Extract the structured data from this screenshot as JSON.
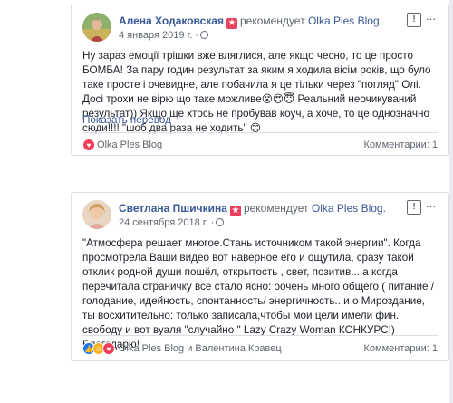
{
  "posts": [
    {
      "author": "Алена Ходаковская",
      "rec_text": "рекомендует",
      "page": "Olka Ples Blog.",
      "date": "4 января 2019 г. ·",
      "text": "Ну зараз емоції трішки вже вляглися, але якщо чесно, то це просто БОМБА! За пару годин результат за яким я ходила вісім років, що було таке просте і очевидне, але побачила я це тільки через \"погляд\" Олі. Досі трохи не вірю що таке можливе😵😍😇 Реальний неочикуваний результат)) Якщо ще хтось не пробував коуч, а хоче, то це однозначно сюди!!!! \"шоб два раза не ходить\" 😊",
      "translate": "Показать перевод",
      "reactions_by": "Olka Ples Blog",
      "comments": "Комментарии: 1"
    },
    {
      "author": "Светлана Пшичкина",
      "rec_text": "рекомендует",
      "page": "Olka Ples Blog.",
      "date": "24 сентября 2018 г. ·",
      "text": "\"Атмосфера решает многое.Стань источником такой энергии\". Когда просмотрела Ваши видео вот наверное его и ощутила, сразу такой отклик родной души пошёл, открытость , свет, позитив... а когда перечитала страничку все стало ясно: оочень много общего ( питание / голодание, идейность, спонтанность/ энергичность...и о Мироздание, ты восхитительно: только записала,чтобы мои цели имели фин. свободу и вот вуаля \"случайно \" Lazy Crazy Woman КОНКУРС!) Благодарю!",
      "reactions_by": "Olka Ples Blog и Валентина Кравец",
      "comments": "Комментарии: 1"
    }
  ],
  "icons": {
    "badge": "recommend-badge-icon",
    "globe": "globe-icon",
    "flag": "flag-icon",
    "more": "more-icon"
  },
  "colors": {
    "link": "#385898",
    "badge": "#e9405e",
    "love": "#f33e58",
    "like": "#1877f2"
  }
}
